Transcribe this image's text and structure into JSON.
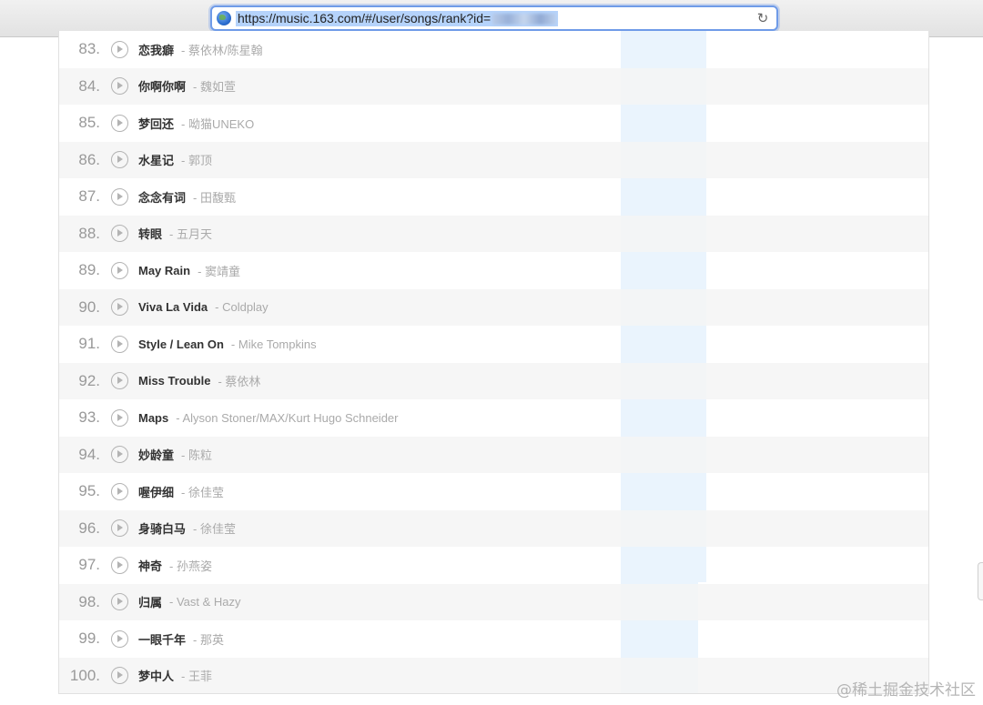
{
  "browser": {
    "url": "https://music.163.com/#/user/songs/rank?id="
  },
  "songs": [
    {
      "rank": "83.",
      "title": "恋我癖",
      "artist": "蔡依林/陈星翰"
    },
    {
      "rank": "84.",
      "title": "你啊你啊",
      "artist": "魏如萱"
    },
    {
      "rank": "85.",
      "title": "梦回还",
      "artist": "呦猫UNEKO"
    },
    {
      "rank": "86.",
      "title": "水星记",
      "artist": "郭顶"
    },
    {
      "rank": "87.",
      "title": "念念有词",
      "artist": "田馥甄"
    },
    {
      "rank": "88.",
      "title": "转眼",
      "artist": "五月天"
    },
    {
      "rank": "89.",
      "title": "May Rain",
      "artist": "窦靖童"
    },
    {
      "rank": "90.",
      "title": "Viva La Vida",
      "artist": "Coldplay"
    },
    {
      "rank": "91.",
      "title": "Style / Lean On",
      "artist": "Mike Tompkins"
    },
    {
      "rank": "92.",
      "title": "Miss Trouble",
      "artist": "蔡依林"
    },
    {
      "rank": "93.",
      "title": "Maps",
      "artist": "Alyson Stoner/MAX/Kurt Hugo Schneider"
    },
    {
      "rank": "94.",
      "title": "妙龄童",
      "artist": "陈粒"
    },
    {
      "rank": "95.",
      "title": "喔伊细",
      "artist": "徐佳莹"
    },
    {
      "rank": "96.",
      "title": "身骑白马",
      "artist": "徐佳莹"
    },
    {
      "rank": "97.",
      "title": "神奇",
      "artist": "孙燕姿"
    },
    {
      "rank": "98.",
      "title": "归属",
      "artist": "Vast & Hazy"
    },
    {
      "rank": "99.",
      "title": "一眼千年",
      "artist": "那英"
    },
    {
      "rank": "100.",
      "title": "梦中人",
      "artist": "王菲"
    }
  ],
  "watermark": "@稀土掘金技术社区"
}
